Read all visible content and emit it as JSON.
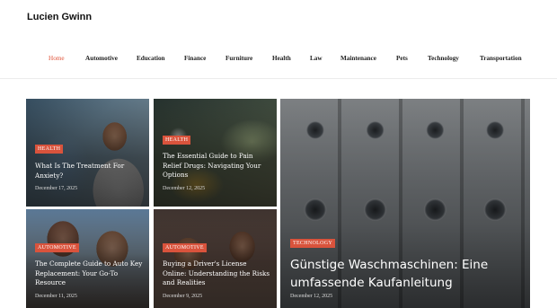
{
  "site": {
    "title": "Lucien Gwinn"
  },
  "nav": {
    "items": [
      {
        "label": "Home"
      },
      {
        "label": "Automotive"
      },
      {
        "label": "Education"
      },
      {
        "label": "Finance"
      },
      {
        "label": "Furniture"
      },
      {
        "label": "Health"
      },
      {
        "label": "Law"
      },
      {
        "label": "Maintenance"
      },
      {
        "label": "Pets"
      },
      {
        "label": "Technology"
      },
      {
        "label": "Transportation"
      }
    ],
    "active": "Home"
  },
  "posts": [
    {
      "category": "HEALTH",
      "title": "What Is The Treatment For Anxiety?",
      "date": "December 17, 2025"
    },
    {
      "category": "HEALTH",
      "title": "The Essential Guide to Pain Relief Drugs: Navigating Your Options",
      "date": "December 12, 2025"
    },
    {
      "category": "AUTOMOTIVE",
      "title": "The Complete Guide to Auto Key Replacement: Your Go-To Resource",
      "date": "December 11, 2025"
    },
    {
      "category": "AUTOMOTIVE",
      "title": "Buying a Driver's License Online: Understanding the Risks and Realities",
      "date": "December 9, 2025"
    }
  ],
  "featured": {
    "category": "TECHNOLOGY",
    "title": "Günstige Waschmaschinen: Eine umfassende Kaufanleitung",
    "date": "December 12, 2025"
  },
  "colors": {
    "accent": "#e0543a",
    "badge": "#d9533c"
  }
}
